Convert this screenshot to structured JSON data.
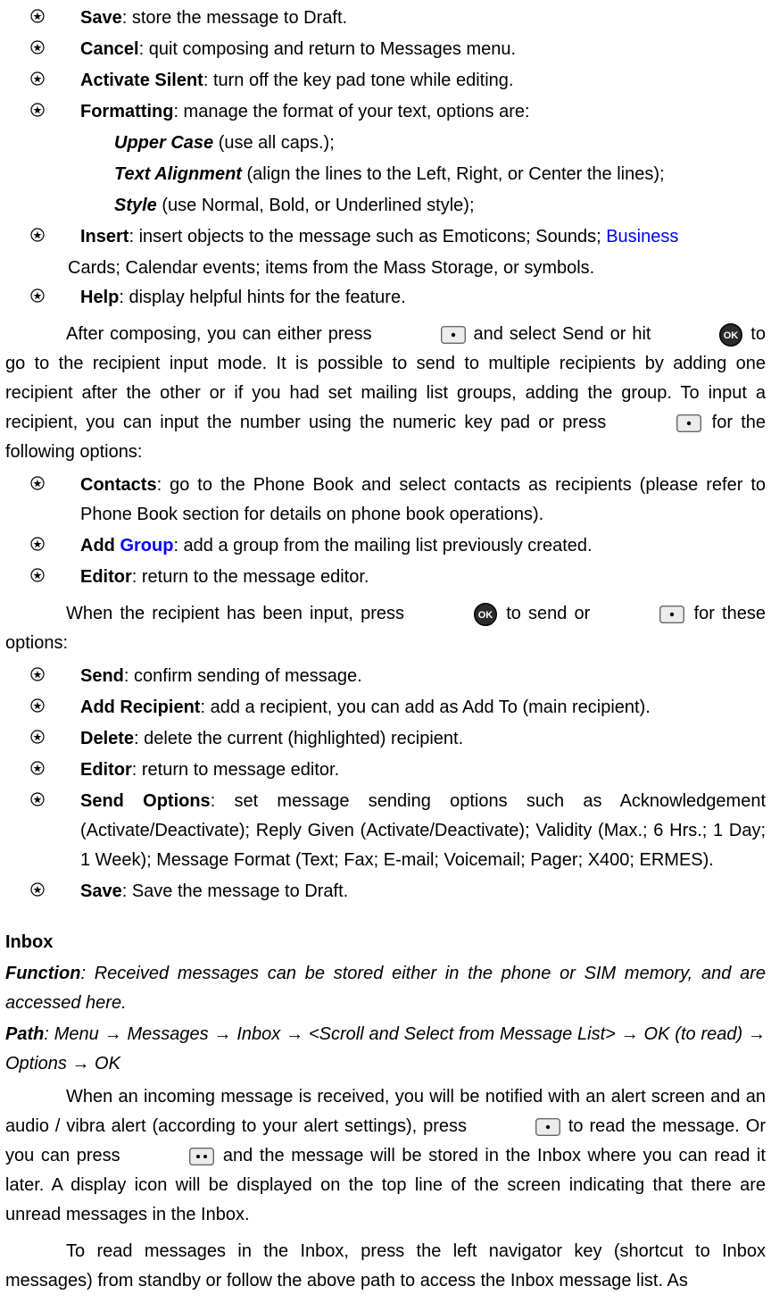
{
  "list1": [
    {
      "term": "Save",
      "desc": ": store the message to Draft."
    },
    {
      "term": "Cancel",
      "desc": ": quit composing and return to Messages menu."
    },
    {
      "term": "Activate Silent",
      "desc": ": turn off the key pad tone while editing."
    },
    {
      "term": "Formatting",
      "desc": ": manage the format of your text, options are:"
    }
  ],
  "sublist": [
    {
      "term": "Upper Case",
      "desc": " (use all caps.);"
    },
    {
      "term": "Text Alignment",
      "desc": " (align the lines to the Left, Right, or Center the lines);"
    },
    {
      "term": "Style",
      "desc": " (use Normal, Bold, or Underlined style);"
    }
  ],
  "insert": {
    "term": "Insert",
    "desc_before_blue": ": insert objects to the message such as Emoticons; Sounds; ",
    "blue": "Business",
    "desc_after": " Cards; Calendar events; items from the Mass Storage, or symbols."
  },
  "help": {
    "term": "Help",
    "desc": ": display helpful hints for the feature."
  },
  "para1": {
    "a": "After composing, you can either press ",
    "b": " and select Send or hit ",
    "c": " to go to the recipient input mode. It is possible to send to multiple recipients by adding one recipient after the other or if you had set mailing list groups, adding the group. To input a recipient, you can input the number using the numeric key pad or press ",
    "d": " for the following options:"
  },
  "list2": {
    "contacts": {
      "term": "Contacts",
      "desc": ": go to the Phone Book and select contacts as recipients (please refer to Phone Book section for details on phone book operations)."
    },
    "addgroup": {
      "term_a": "Add ",
      "term_blue": "Group",
      "desc": ": add a group from the mailing list previously created."
    },
    "editor": {
      "term": "Editor",
      "desc": ": return to the message editor."
    }
  },
  "para2": {
    "a": "When the recipient has been input, press ",
    "b": " to send or ",
    "c": " for these options:"
  },
  "list3": [
    {
      "term": "Send",
      "desc": ": confirm sending of message."
    },
    {
      "term": "Add Recipient",
      "desc": ": add a recipient, you can add as Add To (main recipient)."
    },
    {
      "term": "Delete",
      "desc": ": delete the current (highlighted) recipient."
    },
    {
      "term": "Editor",
      "desc": ": return to message editor."
    },
    {
      "term": "Send Options",
      "desc": ": set message sending options such as Acknowledgement (Activate/Deactivate); Reply Given (Activate/Deactivate); Validity (Max.; 6 Hrs.; 1 Day; 1 Week); Message Format (Text; Fax; E-mail; Voicemail; Pager; X400; ERMES)."
    },
    {
      "term": "Save",
      "desc": ": Save the message to Draft."
    }
  ],
  "inbox": {
    "heading": "Inbox",
    "func_label": "Function",
    "func_text": ": Received messages can be stored either in the phone or SIM memory, and are accessed here.",
    "path_label": "Path",
    "path_a": ": Menu ",
    "path_b": " Messages ",
    "path_c": " Inbox ",
    "path_d": " <Scroll and Select from Message List> ",
    "path_e": " OK (to read) ",
    "path_f": " Options ",
    "path_g": " OK",
    "arrow": "→",
    "p1a": "When an incoming message is received, you will be notified with an alert screen and an audio / vibra alert (according to your alert settings), press ",
    "p1b": " to read the message. Or you can press ",
    "p1c": " and the message will be stored in the Inbox where you can read it later. A display icon will be displayed on the top line of the screen indicating that there are unread messages in the Inbox.",
    "p2": "To read messages in the Inbox, press the left navigator key (shortcut to Inbox messages) from standby or follow the above path to access the Inbox message list. As"
  }
}
